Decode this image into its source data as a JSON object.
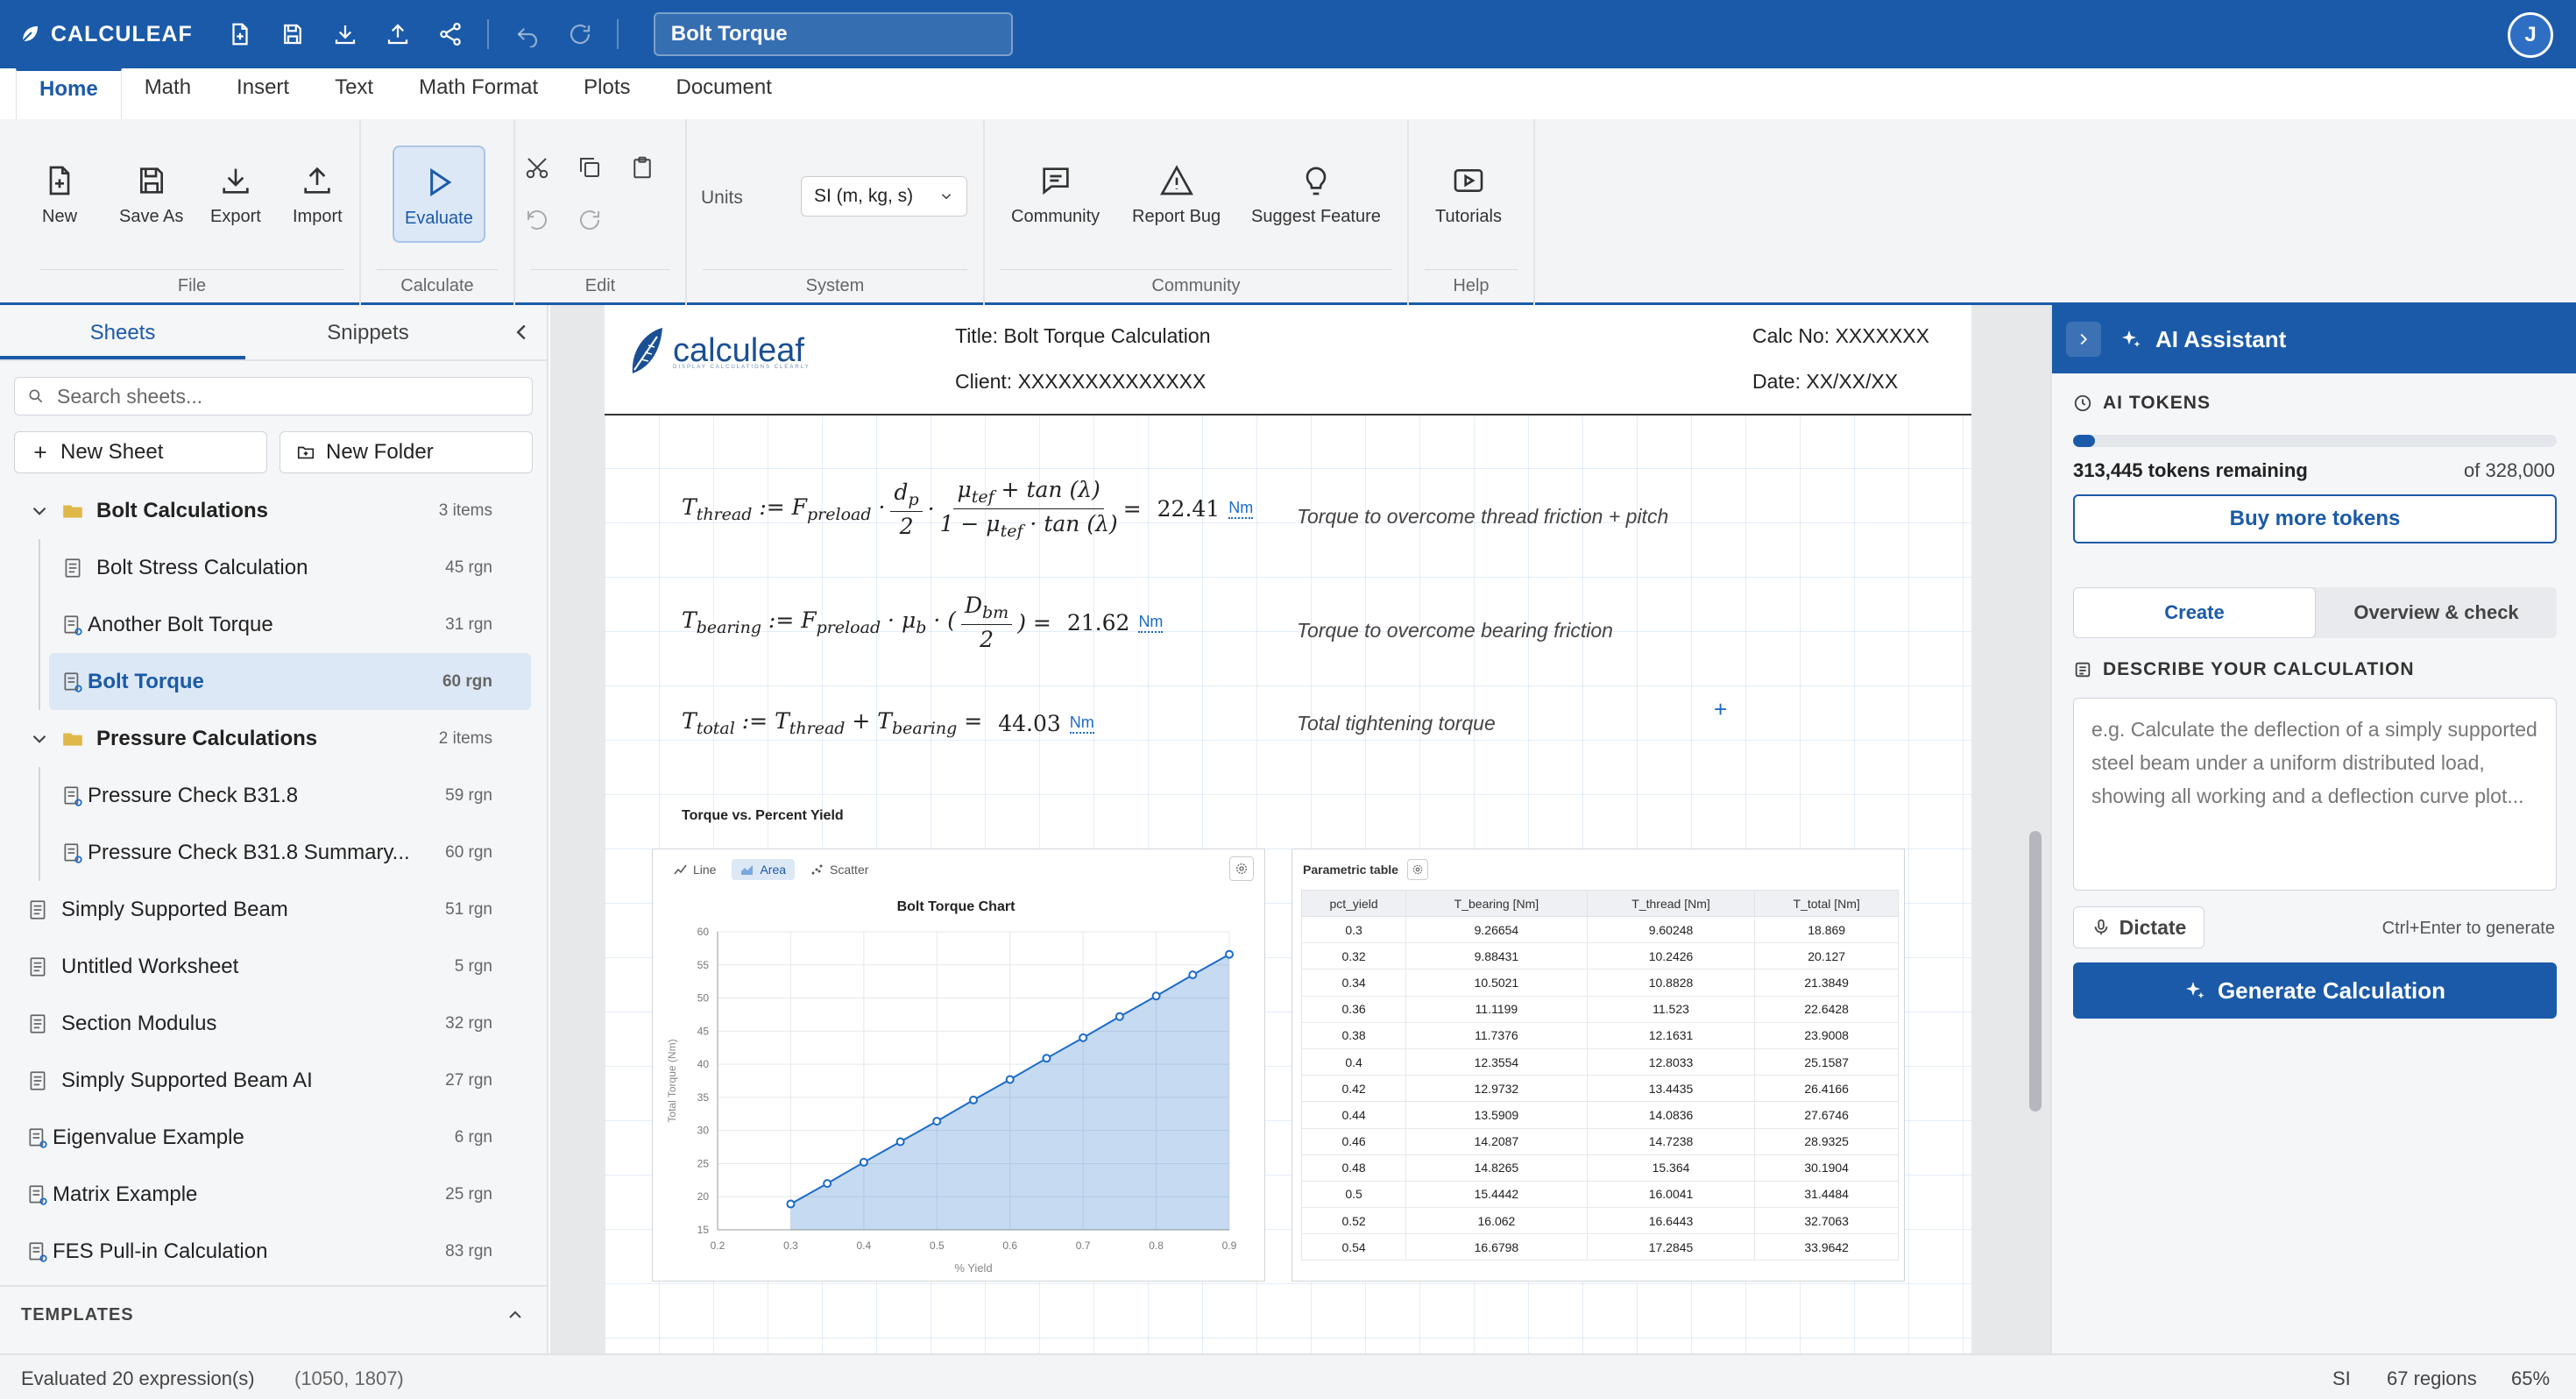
{
  "app": {
    "name": "CALCULEAF",
    "document_title": "Bolt Torque",
    "user_initial": "J"
  },
  "menu_tabs": [
    "Home",
    "Math",
    "Insert",
    "Text",
    "Math Format",
    "Plots",
    "Document"
  ],
  "ribbon": {
    "file": {
      "label": "File",
      "new": "New",
      "save_as": "Save As",
      "export": "Export",
      "import": "Import"
    },
    "calculate": {
      "label": "Calculate",
      "evaluate": "Evaluate"
    },
    "edit": {
      "label": "Edit"
    },
    "system": {
      "label": "System",
      "units_label": "Units",
      "units_value": "SI (m, kg, s)"
    },
    "community": {
      "label": "Community",
      "community": "Community",
      "report_bug": "Report Bug",
      "suggest_feature": "Suggest Feature"
    },
    "help": {
      "label": "Help",
      "tutorials": "Tutorials"
    }
  },
  "sidebar": {
    "tabs": [
      "Sheets",
      "Snippets"
    ],
    "search_placeholder": "Search sheets...",
    "new_sheet": "New Sheet",
    "new_folder": "New Folder",
    "folders": [
      {
        "name": "Bolt Calculations",
        "count": "3 items",
        "items": [
          {
            "name": "Bolt Stress Calculation",
            "regions": "45 rgn"
          },
          {
            "name": "Another Bolt Torque",
            "regions": "31 rgn"
          },
          {
            "name": "Bolt Torque",
            "regions": "60 rgn"
          }
        ]
      },
      {
        "name": "Pressure Calculations",
        "count": "2 items",
        "items": [
          {
            "name": "Pressure Check B31.8",
            "regions": "59 rgn"
          },
          {
            "name": "Pressure Check B31.8 Summary...",
            "regions": "60 rgn"
          }
        ]
      }
    ],
    "sheets": [
      {
        "name": "Simply Supported Beam",
        "regions": "51 rgn"
      },
      {
        "name": "Untitled Worksheet",
        "regions": "5 rgn"
      },
      {
        "name": "Section Modulus",
        "regions": "32 rgn"
      },
      {
        "name": "Simply Supported Beam AI",
        "regions": "27 rgn"
      },
      {
        "name": "Eigenvalue Example",
        "regions": "6 rgn"
      },
      {
        "name": "Matrix Example",
        "regions": "25 rgn"
      },
      {
        "name": "FES Pull-in Calculation",
        "regions": "83 rgn"
      }
    ],
    "templates_label": "TEMPLATES"
  },
  "sheet": {
    "brand_word": "calculeaf",
    "brand_tagline": "DISPLAY CALCULATIONS CLEARLY",
    "title": "Title: Bolt Torque Calculation",
    "client": "Client: XXXXXXXXXXXXXX",
    "calc_no": "Calc No: XXXXXXX",
    "date": "Date: XX/XX/XX",
    "equations": [
      {
        "result": "22.41",
        "unit": "Nm",
        "comment": "Torque to overcome thread friction + pitch"
      },
      {
        "result": "21.62",
        "unit": "Nm",
        "comment": "Torque to overcome bearing friction"
      },
      {
        "result": "44.03",
        "unit": "Nm",
        "comment": "Total tightening torque"
      }
    ],
    "plot_title": "Torque vs. Percent Yield",
    "plot_modes": [
      "Line",
      "Area",
      "Scatter"
    ],
    "table_title": "Parametric table",
    "table_headers": [
      "pct_yield",
      "T_bearing [Nm]",
      "T_thread [Nm]",
      "T_total [Nm]"
    ],
    "table_rows": [
      [
        "0.3",
        "9.26654",
        "9.60248",
        "18.869"
      ],
      [
        "0.32",
        "9.88431",
        "10.2426",
        "20.127"
      ],
      [
        "0.34",
        "10.5021",
        "10.8828",
        "21.3849"
      ],
      [
        "0.36",
        "11.1199",
        "11.523",
        "22.6428"
      ],
      [
        "0.38",
        "11.7376",
        "12.1631",
        "23.9008"
      ],
      [
        "0.4",
        "12.3554",
        "12.8033",
        "25.1587"
      ],
      [
        "0.42",
        "12.9732",
        "13.4435",
        "26.4166"
      ],
      [
        "0.44",
        "13.5909",
        "14.0836",
        "27.6746"
      ],
      [
        "0.46",
        "14.2087",
        "14.7238",
        "28.9325"
      ],
      [
        "0.48",
        "14.8265",
        "15.364",
        "30.1904"
      ],
      [
        "0.5",
        "15.4442",
        "16.0041",
        "31.4484"
      ],
      [
        "0.52",
        "16.062",
        "16.6443",
        "32.7063"
      ],
      [
        "0.54",
        "16.6798",
        "17.2845",
        "33.9642"
      ]
    ]
  },
  "chart_data": {
    "type": "area",
    "title": "Bolt Torque Chart",
    "xlabel": "% Yield",
    "ylabel": "Total Torque (Nm)",
    "xlim": [
      0.2,
      0.9
    ],
    "ylim": [
      15,
      60
    ],
    "x_ticks": [
      "0.2",
      "0.3",
      "0.4",
      "0.5",
      "0.6",
      "0.7",
      "0.8",
      "0.9"
    ],
    "y_ticks": [
      "15",
      "20",
      "25",
      "30",
      "35",
      "40",
      "45",
      "50",
      "55",
      "60"
    ],
    "grid": true,
    "x": [
      0.3,
      0.35,
      0.4,
      0.45,
      0.5,
      0.55,
      0.6,
      0.65,
      0.7,
      0.75,
      0.8,
      0.85,
      0.9
    ],
    "y": [
      18.9,
      22.0,
      25.2,
      28.3,
      31.4,
      34.6,
      37.7,
      40.9,
      44.0,
      47.2,
      50.3,
      53.5,
      56.6
    ],
    "color": "#1b6bc8"
  },
  "ai": {
    "title": "AI Assistant",
    "tokens_label": "AI TOKENS",
    "tokens_remaining": "313,445 tokens remaining",
    "tokens_total": "of 328,000",
    "tokens_fraction": 0.0444,
    "buy_more": "Buy more tokens",
    "tabs": [
      "Create",
      "Overview & check"
    ],
    "describe_label": "DESCRIBE YOUR CALCULATION",
    "placeholder": "e.g. Calculate the deflection of a simply supported steel beam under a uniform distributed load, showing all working and a deflection curve plot...",
    "dictate": "Dictate",
    "hint": "Ctrl+Enter to generate",
    "generate": "Generate Calculation"
  },
  "status": {
    "message": "Evaluated 20 expression(s)",
    "coords": "(1050, 1807)",
    "unit_system": "SI",
    "regions": "67 regions",
    "zoom": "65%"
  },
  "colors": {
    "brand": "#1b5aa8",
    "accent": "#1b6bc8",
    "selection": "#dde8f6"
  }
}
